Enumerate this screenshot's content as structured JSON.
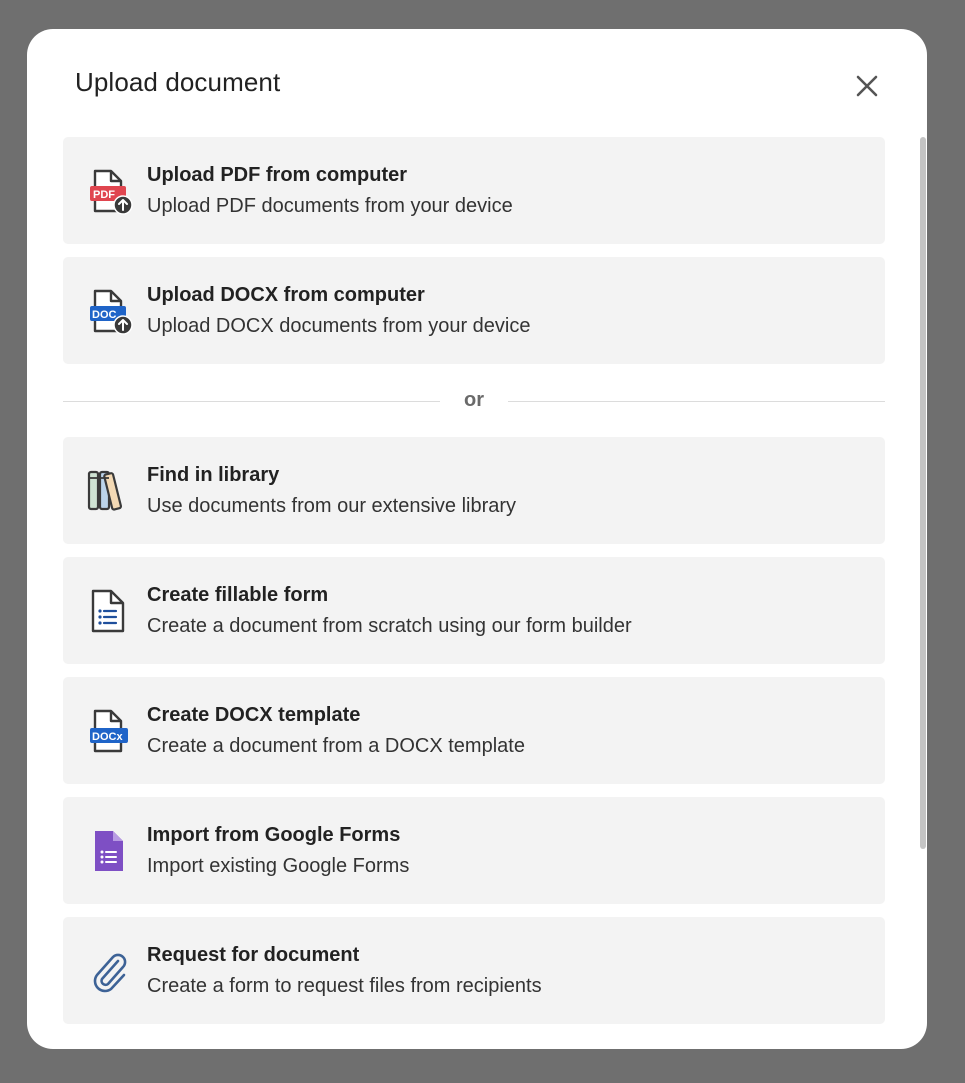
{
  "modal": {
    "title": "Upload document",
    "close_icon": "close-icon"
  },
  "upload_options": [
    {
      "title": "Upload PDF from computer",
      "description": "Upload PDF documents from your device",
      "icon": "pdf-upload-icon",
      "badge": "PDF"
    },
    {
      "title": "Upload DOCX from computer",
      "description": "Upload DOCX documents from your device",
      "icon": "docx-upload-icon",
      "badge": "DOC"
    }
  ],
  "divider": {
    "label": "or"
  },
  "create_options": [
    {
      "title": "Find in library",
      "description": "Use documents from our extensive library",
      "icon": "library-books-icon"
    },
    {
      "title": "Create fillable form",
      "description": "Create a document from scratch using our form builder",
      "icon": "form-document-icon"
    },
    {
      "title": "Create DOCX template",
      "description": "Create a document from a DOCX template",
      "icon": "docx-template-icon",
      "badge": "DOCx"
    },
    {
      "title": "Import from Google Forms",
      "description": "Import existing Google Forms",
      "icon": "google-forms-icon"
    },
    {
      "title": "Request for document",
      "description": "Create a form to request files from recipients",
      "icon": "paperclip-icon"
    }
  ],
  "colors": {
    "backdrop": "#6f6f6f",
    "card": "#f3f3f3",
    "pdf_red": "#e0454f",
    "docx_blue": "#1f64c8",
    "google_forms_purple": "#7e4fc4",
    "paperclip_blue": "#3d6296"
  }
}
